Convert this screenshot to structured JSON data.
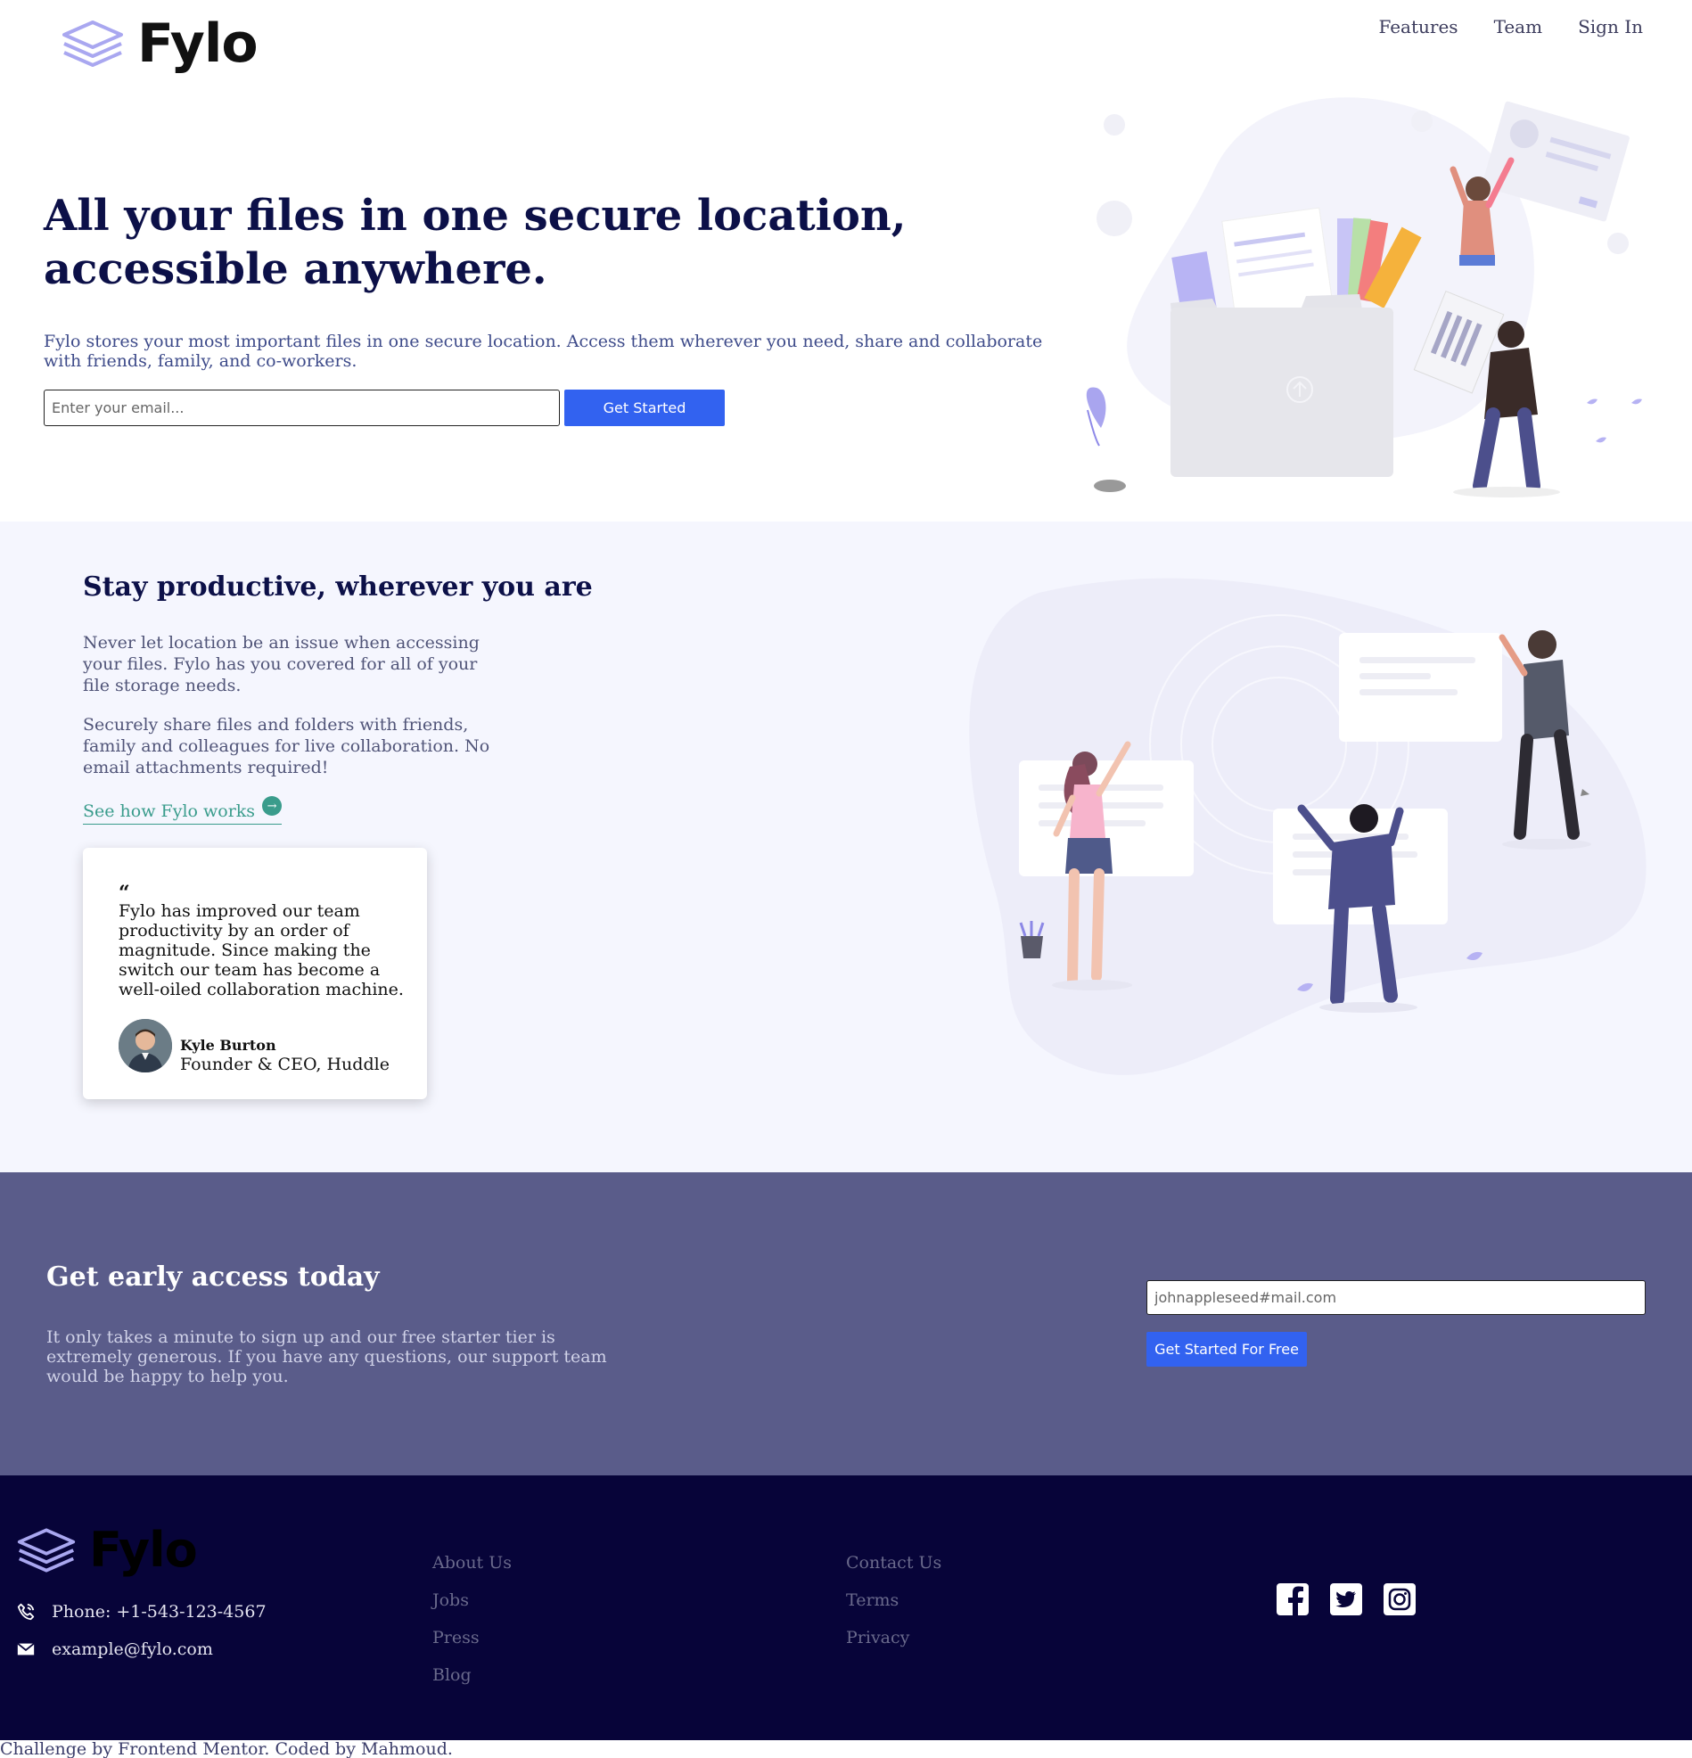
{
  "brand": {
    "name": "Fylo"
  },
  "nav": {
    "items": [
      "Features",
      "Team",
      "Sign In"
    ]
  },
  "hero": {
    "title": "All your files in one secure location, accessible anywhere.",
    "description": "Fylo stores your most important files in one secure location. Access them wherever you need, share and collaborate with friends, family, and co-workers.",
    "email_placeholder": "Enter your email...",
    "cta_label": "Get Started",
    "illustration": "intro-illustration"
  },
  "productive": {
    "title": "Stay productive, wherever you are",
    "para1": "Never let location be an issue when accessing your files. Fylo has you covered for all of your file storage needs.",
    "para2": "Securely share files and folders with friends, family and colleagues for live collaboration. No email attachments required!",
    "link_label": "See how Fylo works",
    "illustration": "stay-productive-illustration",
    "testimonial": {
      "quote_mark": "“",
      "text": "Fylo has improved our team productivity by an order of magnitude. Since making the switch our team has become a well-oiled collaboration machine.",
      "name": "Kyle Burton",
      "role": "Founder & CEO, Huddle"
    }
  },
  "early_access": {
    "title": "Get early access today",
    "description": "It only takes a minute to sign up and our free starter tier is extremely generous. If you have any questions, our support team would be happy to help you.",
    "email_placeholder": "johnappleseed#mail.com",
    "cta_label": "Get Started For Free"
  },
  "footer": {
    "phone": "Phone: +1-543-123-4567",
    "email": "example@fylo.com",
    "links_col1": [
      "About Us",
      "Jobs",
      "Press",
      "Blog"
    ],
    "links_col2": [
      "Contact Us",
      "Terms",
      "Privacy"
    ],
    "socials": [
      "facebook-icon",
      "twitter-icon",
      "instagram-icon"
    ]
  },
  "attribution": "Challenge by Frontend Mentor. Coded by Mahmoud.",
  "colors": {
    "accent_blue": "#3262f0",
    "navy": "#0c1048",
    "teal": "#3a9c8c",
    "early_bg": "#5a5c8a",
    "footer_bg": "#070439",
    "logo_purple": "#a9a7f0"
  }
}
